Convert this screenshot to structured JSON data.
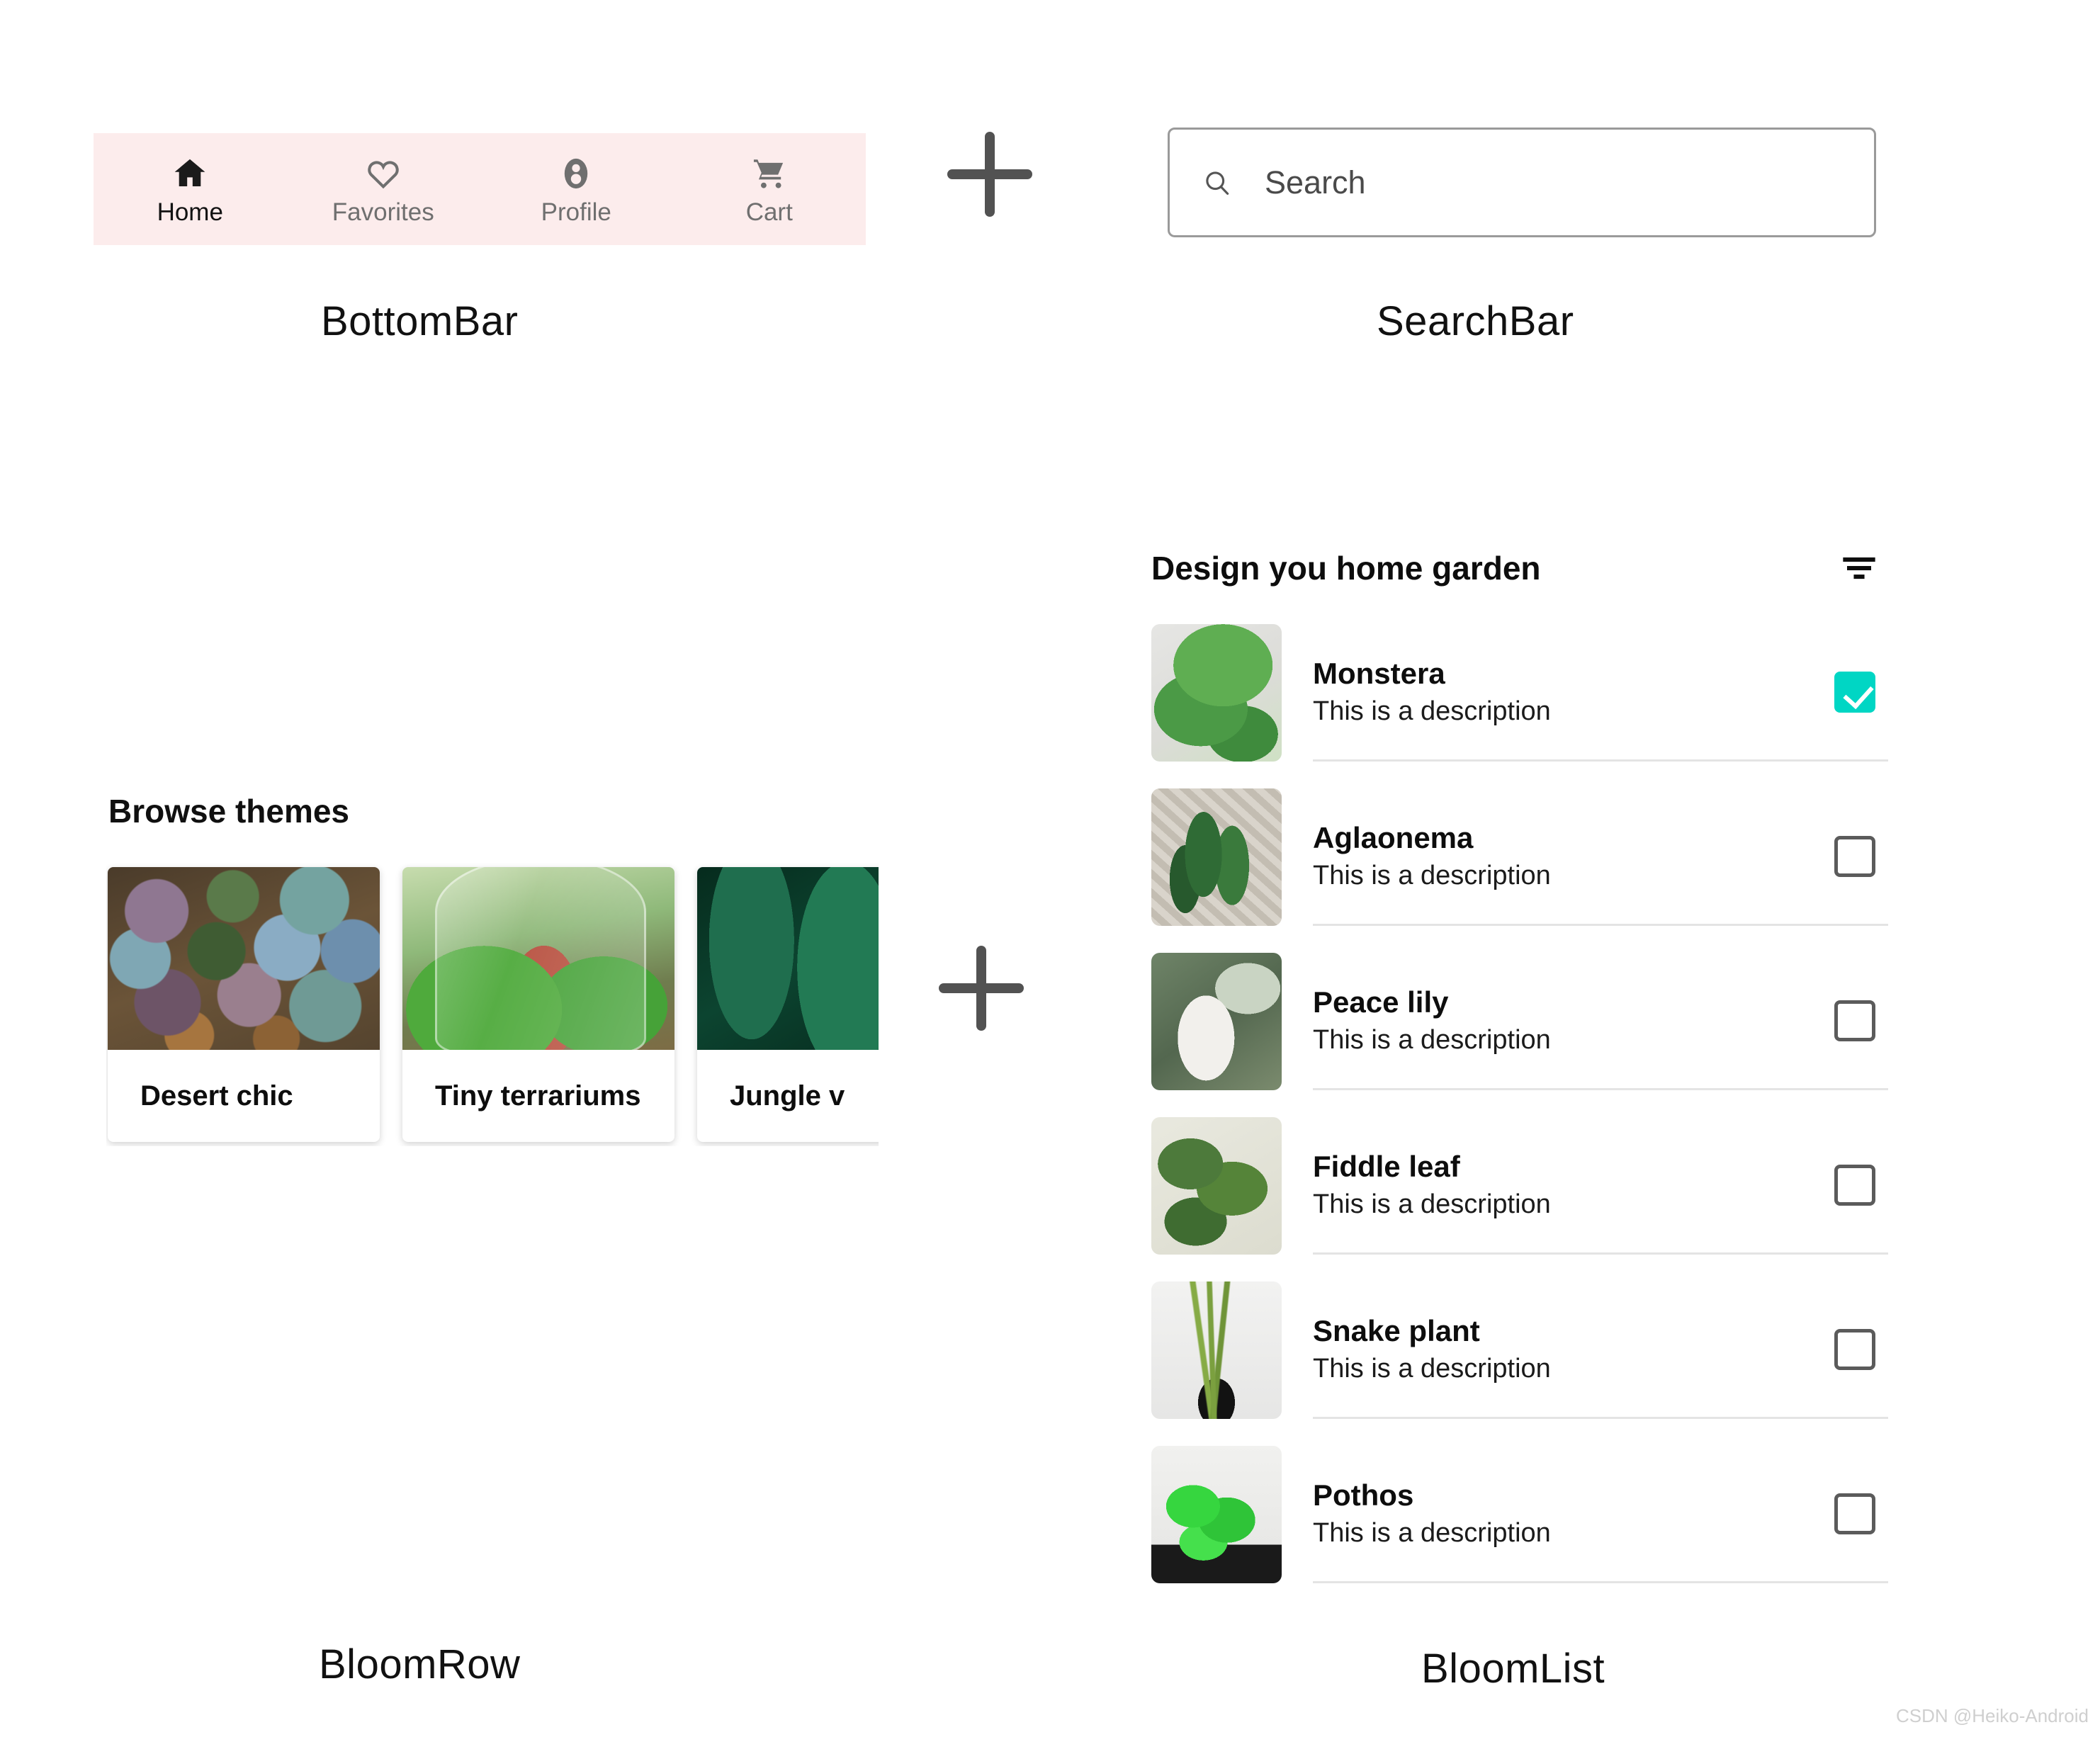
{
  "sections": {
    "bottombar_caption": "BottomBar",
    "searchbar_caption": "SearchBar",
    "bloomrow_caption": "BloomRow",
    "bloomlist_caption": "BloomList"
  },
  "bottombar": {
    "background": "#fcecec",
    "active_index": 0,
    "items": [
      {
        "label": "Home",
        "icon": "home-icon"
      },
      {
        "label": "Favorites",
        "icon": "heart-icon"
      },
      {
        "label": "Profile",
        "icon": "account-circle-icon"
      },
      {
        "label": "Cart",
        "icon": "shopping-cart-icon"
      }
    ]
  },
  "searchbar": {
    "placeholder": "Search",
    "value": "",
    "icon": "search-icon",
    "border_color": "#9a9a9a"
  },
  "bloomrow": {
    "title": "Browse themes",
    "cards": [
      {
        "label": "Desert chic",
        "thumb": "succulent-garden-photo"
      },
      {
        "label": "Tiny terrariums",
        "thumb": "terrarium-jar-photo"
      },
      {
        "label": "Jungle v",
        "thumb": "dark-jungle-leaves-photo"
      }
    ]
  },
  "bloomlist": {
    "title": "Design you home garden",
    "filter_icon": "filter-list-icon",
    "checked_color": "#00d6c4",
    "unchecked_border_color": "#5b5b5b",
    "items": [
      {
        "name": "Monstera",
        "description": "This is a description",
        "checked": true,
        "thumb": "monstera-photo"
      },
      {
        "name": "Aglaonema",
        "description": "This is a description",
        "checked": false,
        "thumb": "aglaonema-photo"
      },
      {
        "name": "Peace lily",
        "description": "This is a description",
        "checked": false,
        "thumb": "peace-lily-photo"
      },
      {
        "name": "Fiddle leaf",
        "description": "This is a description",
        "checked": false,
        "thumb": "fiddle-leaf-photo"
      },
      {
        "name": "Snake plant",
        "description": "This is a description",
        "checked": false,
        "thumb": "snake-plant-photo"
      },
      {
        "name": "Pothos",
        "description": "This is a description",
        "checked": false,
        "thumb": "pothos-photo"
      }
    ]
  },
  "watermark": {
    "text": "CSDN @Heiko-Android"
  }
}
